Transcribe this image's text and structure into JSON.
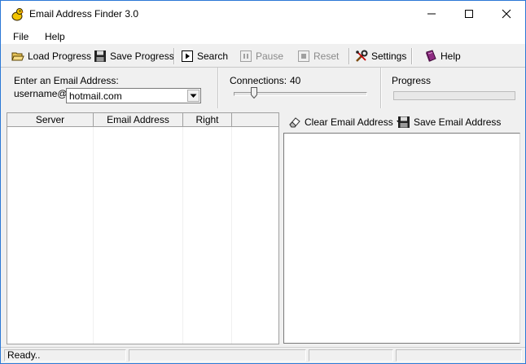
{
  "window": {
    "title": "Email Address Finder 3.0"
  },
  "menu": [
    "File",
    "Help"
  ],
  "toolbar": {
    "load": "Load Progress",
    "save": "Save Progress",
    "search": "Search",
    "pause": "Pause",
    "reset": "Reset",
    "settings": "Settings",
    "help": "Help"
  },
  "input_panel": {
    "label": "Enter an Email Address:",
    "prefix": "username@",
    "domain_value": "hotmail.com"
  },
  "connections": {
    "label": "Connections:",
    "value": "40",
    "slider_level": 0.15
  },
  "progress": {
    "label": "Progress",
    "fraction": 0
  },
  "grid": {
    "columns": [
      "Server",
      "Email Address",
      "Right"
    ]
  },
  "results": {
    "clear": "Clear Email Address",
    "save": "Save Email Address"
  },
  "status": {
    "text": "Ready.."
  }
}
